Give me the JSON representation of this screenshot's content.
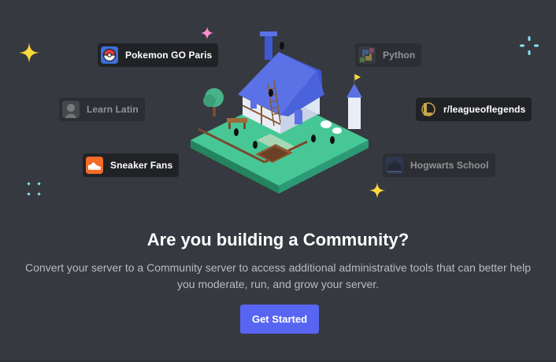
{
  "title": "Are you building a Community?",
  "description": "Convert your server to a Community server to access additional administrative tools that can better help you moderate, run, and grow your server.",
  "cta": {
    "label": "Get Started"
  },
  "servers": {
    "pokemon": {
      "name": "Pokemon GO Paris",
      "icon": "pokeball-icon"
    },
    "latin": {
      "name": "Learn Latin",
      "icon": "bust-statue-icon"
    },
    "sneaker": {
      "name": "Sneaker Fans",
      "icon": "sneaker-icon"
    },
    "python": {
      "name": "Python",
      "icon": "python-logo-icon"
    },
    "lol": {
      "name": "r/leagueoflegends",
      "icon": "league-logo-icon"
    },
    "hogwarts": {
      "name": "Hogwarts School",
      "icon": "castle-icon"
    }
  },
  "colors": {
    "background": "#36393f",
    "pill_background": "#202225",
    "accent": "#5865f2",
    "headline": "#ffffff",
    "description": "#b9bbbe",
    "sparkle_yellow": "#fcd93b",
    "sparkle_pink": "#ff8fd0",
    "sparkle_cyan": "#86e3f5"
  }
}
